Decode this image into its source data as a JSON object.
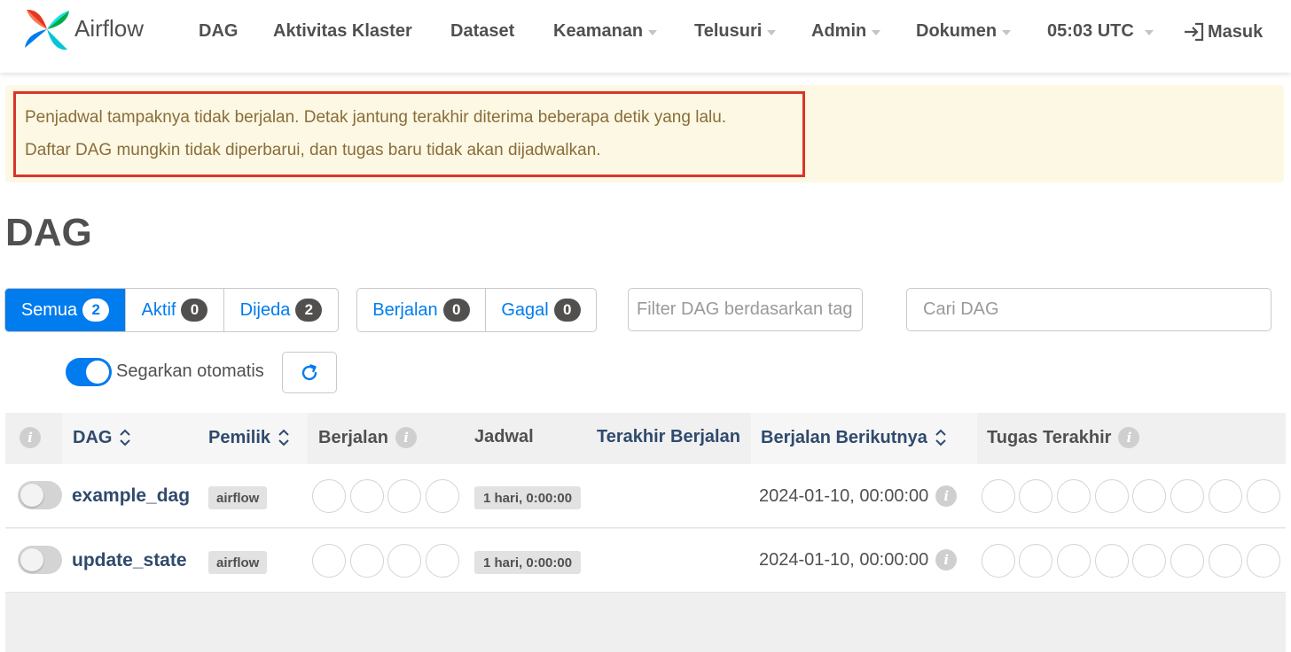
{
  "brand": {
    "name": "Airflow"
  },
  "nav": {
    "items": [
      {
        "label": "DAG",
        "dropdown": false
      },
      {
        "label": "Aktivitas Klaster",
        "dropdown": false
      },
      {
        "label": "Dataset",
        "dropdown": false
      },
      {
        "label": "Keamanan",
        "dropdown": true
      },
      {
        "label": "Telusuri",
        "dropdown": true
      },
      {
        "label": "Admin",
        "dropdown": true
      },
      {
        "label": "Dokumen",
        "dropdown": true
      }
    ],
    "time": "05:03 UTC",
    "login_label": "Masuk"
  },
  "alert": {
    "line1": "Penjadwal tampaknya tidak berjalan. Detak jantung terakhir diterima beberapa detik yang lalu.",
    "line2": "Daftar DAG mungkin tidak diperbarui, dan tugas baru tidak akan dijadwalkan."
  },
  "page_title": "DAG",
  "filters": {
    "status": [
      {
        "label": "Semua",
        "count": "2",
        "active": true
      },
      {
        "label": "Aktif",
        "count": "0",
        "active": false
      },
      {
        "label": "Dijeda",
        "count": "2",
        "active": false
      }
    ],
    "runs": [
      {
        "label": "Berjalan",
        "count": "0"
      },
      {
        "label": "Gagal",
        "count": "0"
      }
    ],
    "tag_placeholder": "Filter DAG berdasarkan tag",
    "search_placeholder": "Cari DAG"
  },
  "auto_refresh": {
    "label": "Segarkan otomatis",
    "enabled": true
  },
  "table": {
    "headers": {
      "dag": "DAG",
      "owner": "Pemilik",
      "runs": "Berjalan",
      "schedule": "Jadwal",
      "last_run": "Terakhir Berjalan",
      "next_run": "Berjalan Berikutnya",
      "recent_tasks": "Tugas Terakhir"
    },
    "rows": [
      {
        "dag_id": "example_dag",
        "owner": "airflow",
        "schedule": "1 hari, 0:00:00",
        "last_run": "",
        "next_run": "2024-01-10, 00:00:00",
        "paused": true
      },
      {
        "dag_id": "update_state",
        "owner": "airflow",
        "schedule": "1 hari, 0:00:00",
        "last_run": "",
        "next_run": "2024-01-10, 00:00:00",
        "paused": true
      }
    ]
  },
  "colors": {
    "accent": "#017cee",
    "alert_border": "#d9352b",
    "alert_bg": "#fcf8e3",
    "alert_text": "#8a6d3b",
    "link": "#2f4a6d"
  },
  "icons": {
    "logo": "airflow-pinwheel-icon",
    "login": "sign-in-icon",
    "refresh": "refresh-icon",
    "info": "info-icon",
    "sort": "sort-icon"
  }
}
